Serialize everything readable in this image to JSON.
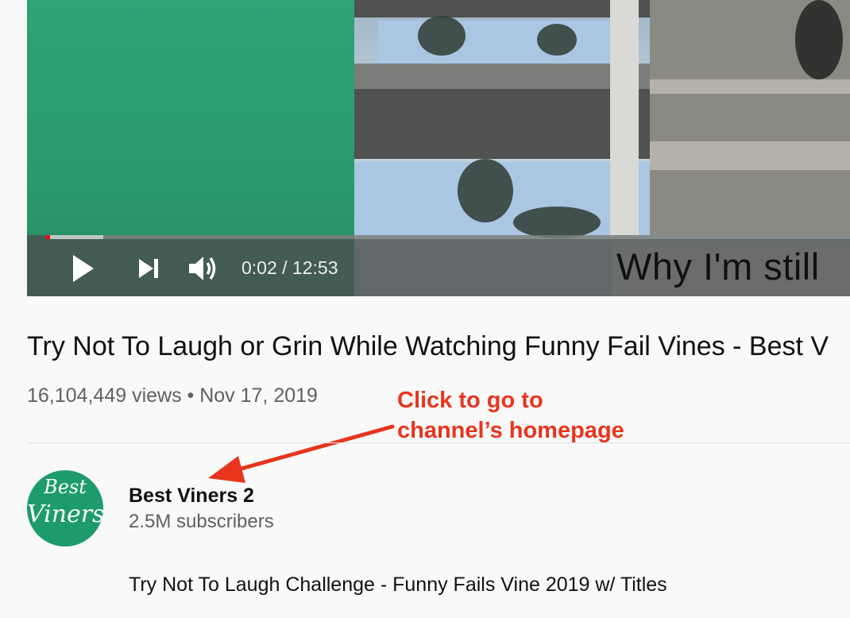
{
  "player": {
    "time_display": "0:02 / 12:53",
    "caption_text": "Why I'm still",
    "progress_fraction": 0.0016,
    "buffered_fraction": 0.07,
    "progress_color": "#ff0000"
  },
  "video": {
    "title": "Try Not To Laugh or Grin While Watching Funny Fail Vines - Best V",
    "stats": "16,104,449 views • Nov 17, 2019"
  },
  "annotation": {
    "text": "Click to go to\nchannel’s homepage",
    "color": "#e8351e"
  },
  "channel": {
    "avatar_line1": "Best",
    "avatar_line2": "Viners",
    "name": "Best Viners 2",
    "subscribers": "2.5M subscribers",
    "avatar_color": "#1e9b6c"
  },
  "description": {
    "text": "Try Not To Laugh Challenge - Funny Fails Vine 2019 w/ Titles"
  },
  "icons": [
    "play-icon",
    "next-icon",
    "volume-icon"
  ]
}
